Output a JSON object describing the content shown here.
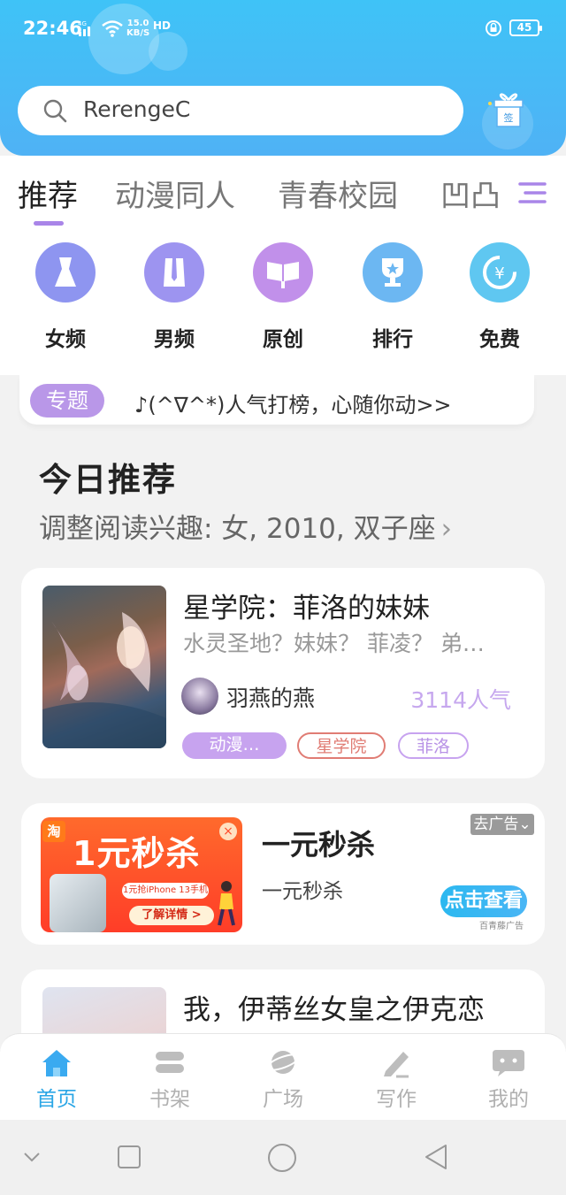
{
  "status_bar": {
    "time": "22:46",
    "network": "4G",
    "speed": "15.0\nKB/S",
    "hd": "HD",
    "battery": "45"
  },
  "search": {
    "text": "RerengeC"
  },
  "category_tabs": [
    {
      "label": "推荐",
      "active": true
    },
    {
      "label": "动漫同人",
      "active": false
    },
    {
      "label": "青春校园",
      "active": false
    },
    {
      "label": "凹凸",
      "active": false
    }
  ],
  "quick_nav": [
    {
      "label": "女频",
      "icon": "dress-icon",
      "color": "#8e8ff0"
    },
    {
      "label": "男频",
      "icon": "shirt-icon",
      "color": "#9a8ef0"
    },
    {
      "label": "原创",
      "icon": "book-icon",
      "color": "#c08ee8"
    },
    {
      "label": "排行",
      "icon": "trophy-icon",
      "color": "#6fb6f2"
    },
    {
      "label": "免费",
      "icon": "yuan-icon",
      "color": "#5ec8f0"
    }
  ],
  "topic": {
    "badge": "专题",
    "text": "♪(^∇^*)人气打榜，心随你动>>"
  },
  "today": {
    "title": "今日推荐",
    "subtitle": "调整阅读兴趣: 女, 2010, 双子座",
    "chevron": "›"
  },
  "books": [
    {
      "title": "星学院：菲洛的妹妹",
      "desc": "水灵圣地？妹妹？ 菲凌？ 弟…",
      "author": "羽燕的燕",
      "popularity": "3114人气",
      "tags": [
        "动漫…",
        "星学院",
        "菲洛"
      ]
    },
    {
      "title": "我，伊蒂丝女皇之伊克恋"
    }
  ],
  "ad": {
    "image_big": "1元秒杀",
    "image_tao": "淘",
    "image_small": "1元抢iPhone 13手机",
    "image_button": "了解详情 >",
    "title": "一元秒杀",
    "subtitle": "一元秒杀",
    "close_label": "去广告⌄",
    "view_label": "点击查看",
    "source": "百青藤广告"
  },
  "bottom_nav": [
    {
      "label": "首页",
      "active": true
    },
    {
      "label": "书架",
      "active": false
    },
    {
      "label": "广场",
      "active": false
    },
    {
      "label": "写作",
      "active": false
    },
    {
      "label": "我的",
      "active": false
    }
  ],
  "colors": {
    "accent": "#2aa6e6",
    "purple": "#a985e8",
    "header": "#44bcf6"
  }
}
